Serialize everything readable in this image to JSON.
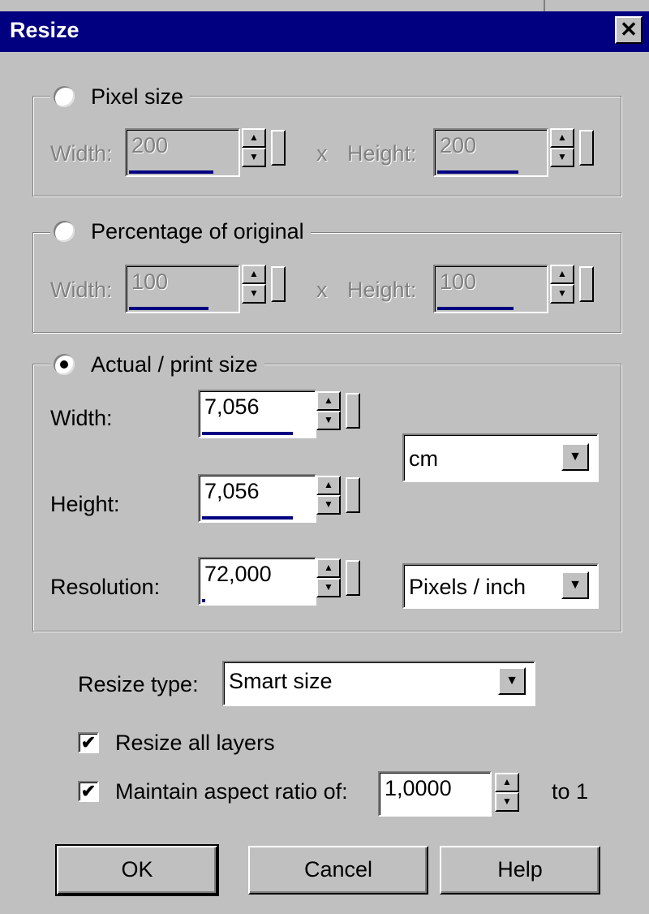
{
  "window": {
    "title": "Resize",
    "close_glyph": "✕"
  },
  "pixel_size": {
    "label": "Pixel size",
    "selected": false,
    "width_label": "Width:",
    "width_value": "200",
    "x_label": "x",
    "height_label": "Height:",
    "height_value": "200"
  },
  "percentage": {
    "label": "Percentage of original",
    "selected": false,
    "width_label": "Width:",
    "width_value": "100",
    "x_label": "x",
    "height_label": "Height:",
    "height_value": "100"
  },
  "actual_size": {
    "label": "Actual / print size",
    "selected": true,
    "width_label": "Width:",
    "width_value": "7,056",
    "height_label": "Height:",
    "height_value": "7,056",
    "resolution_label": "Resolution:",
    "resolution_value": "72,000",
    "unit_selected": "cm",
    "resolution_unit_selected": "Pixels / inch"
  },
  "resize_type": {
    "label": "Resize type:",
    "selected": "Smart size"
  },
  "options": {
    "resize_all_layers": {
      "label": "Resize all layers",
      "checked": true
    },
    "maintain_aspect": {
      "label": "Maintain aspect ratio of:",
      "checked": true,
      "value": "1,0000",
      "suffix": "to 1"
    }
  },
  "buttons": {
    "ok": "OK",
    "cancel": "Cancel",
    "help": "Help"
  },
  "icons": {
    "check": "✔",
    "arrow_up": "▲",
    "arrow_down": "▼",
    "radio_dot": "●"
  },
  "colors": {
    "titlebar": "#000080",
    "face": "#c0c0c0",
    "progress": "#000080",
    "disabled_text": "#808080"
  }
}
